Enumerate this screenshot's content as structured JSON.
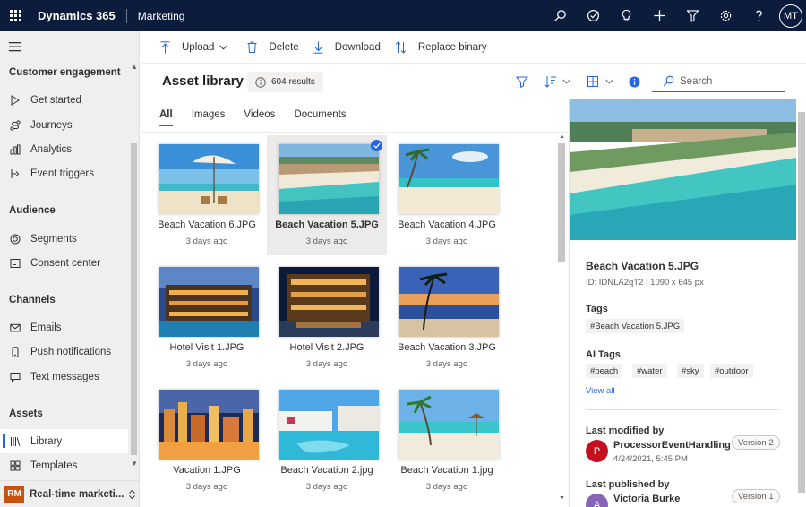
{
  "topbar": {
    "app_name": "Dynamics 365",
    "area_name": "Marketing",
    "icons": [
      "search-icon",
      "task-icon",
      "lightbulb-icon",
      "plus-icon",
      "filter-icon",
      "settings-icon",
      "help-icon"
    ],
    "user_initials": "MT"
  },
  "nav": {
    "groups": [
      {
        "label": "Customer engagement",
        "items": [
          "Get started",
          "Journeys",
          "Analytics",
          "Event triggers"
        ]
      },
      {
        "label": "Audience",
        "items": [
          "Segments",
          "Consent center"
        ]
      },
      {
        "label": "Channels",
        "items": [
          "Emails",
          "Push notifications",
          "Text messages"
        ]
      },
      {
        "label": "Assets",
        "items": [
          "Library",
          "Templates"
        ]
      }
    ],
    "selected": "Library",
    "area_badge": "RM",
    "area_label": "Real-time marketi..."
  },
  "commands": {
    "upload": "Upload",
    "delete": "Delete",
    "download": "Download",
    "replace": "Replace binary"
  },
  "library": {
    "title": "Asset library",
    "results": "604 results",
    "search_placeholder": "Search",
    "tabs": [
      "All",
      "Images",
      "Videos",
      "Documents"
    ],
    "active_tab": "All",
    "assets": [
      {
        "name": "Beach Vacation 6.JPG",
        "date": "3 days ago",
        "scene": "umbrella"
      },
      {
        "name": "Beach Vacation 5.JPG",
        "date": "3 days ago",
        "scene": "aerial",
        "selected": true
      },
      {
        "name": "Beach Vacation 4.JPG",
        "date": "3 days ago",
        "scene": "palm-beach"
      },
      {
        "name": "Hotel Visit 1.JPG",
        "date": "3 days ago",
        "scene": "hotel-dusk"
      },
      {
        "name": "Hotel Visit 2.JPG",
        "date": "3 days ago",
        "scene": "hotel-night"
      },
      {
        "name": "Beach Vacation 3.JPG",
        "date": "3 days ago",
        "scene": "sunset-palm"
      },
      {
        "name": "Vacation 1.JPG",
        "date": "3 days ago",
        "scene": "city-night"
      },
      {
        "name": "Beach Vacation 2.jpg",
        "date": "3 days ago",
        "scene": "pool"
      },
      {
        "name": "Beach Vacation 1.jpg",
        "date": "3 days ago",
        "scene": "beach-day"
      }
    ]
  },
  "detail": {
    "title": "Beach Vacation 5.JPG",
    "meta": "ID: IDNLA2qT2 | 1090 x 645 px",
    "tags_label": "Tags",
    "tags": [
      "#Beach Vacation 5.JPG"
    ],
    "ai_tags_label": "AI Tags",
    "ai_tags": [
      "#beach",
      "#water",
      "#sky",
      "#outdoor"
    ],
    "view_all": "View all",
    "last_modified": {
      "label": "Last modified by",
      "initial": "P",
      "name": "ProcessorEventHandling",
      "date": "4/24/2021, 5:45 PM",
      "version": "Version 2",
      "color": "#c50f1f"
    },
    "last_published": {
      "label": "Last published by",
      "initial": "A",
      "name": "Victoria Burke",
      "version": "Version 1",
      "color": "#8764b8"
    }
  }
}
